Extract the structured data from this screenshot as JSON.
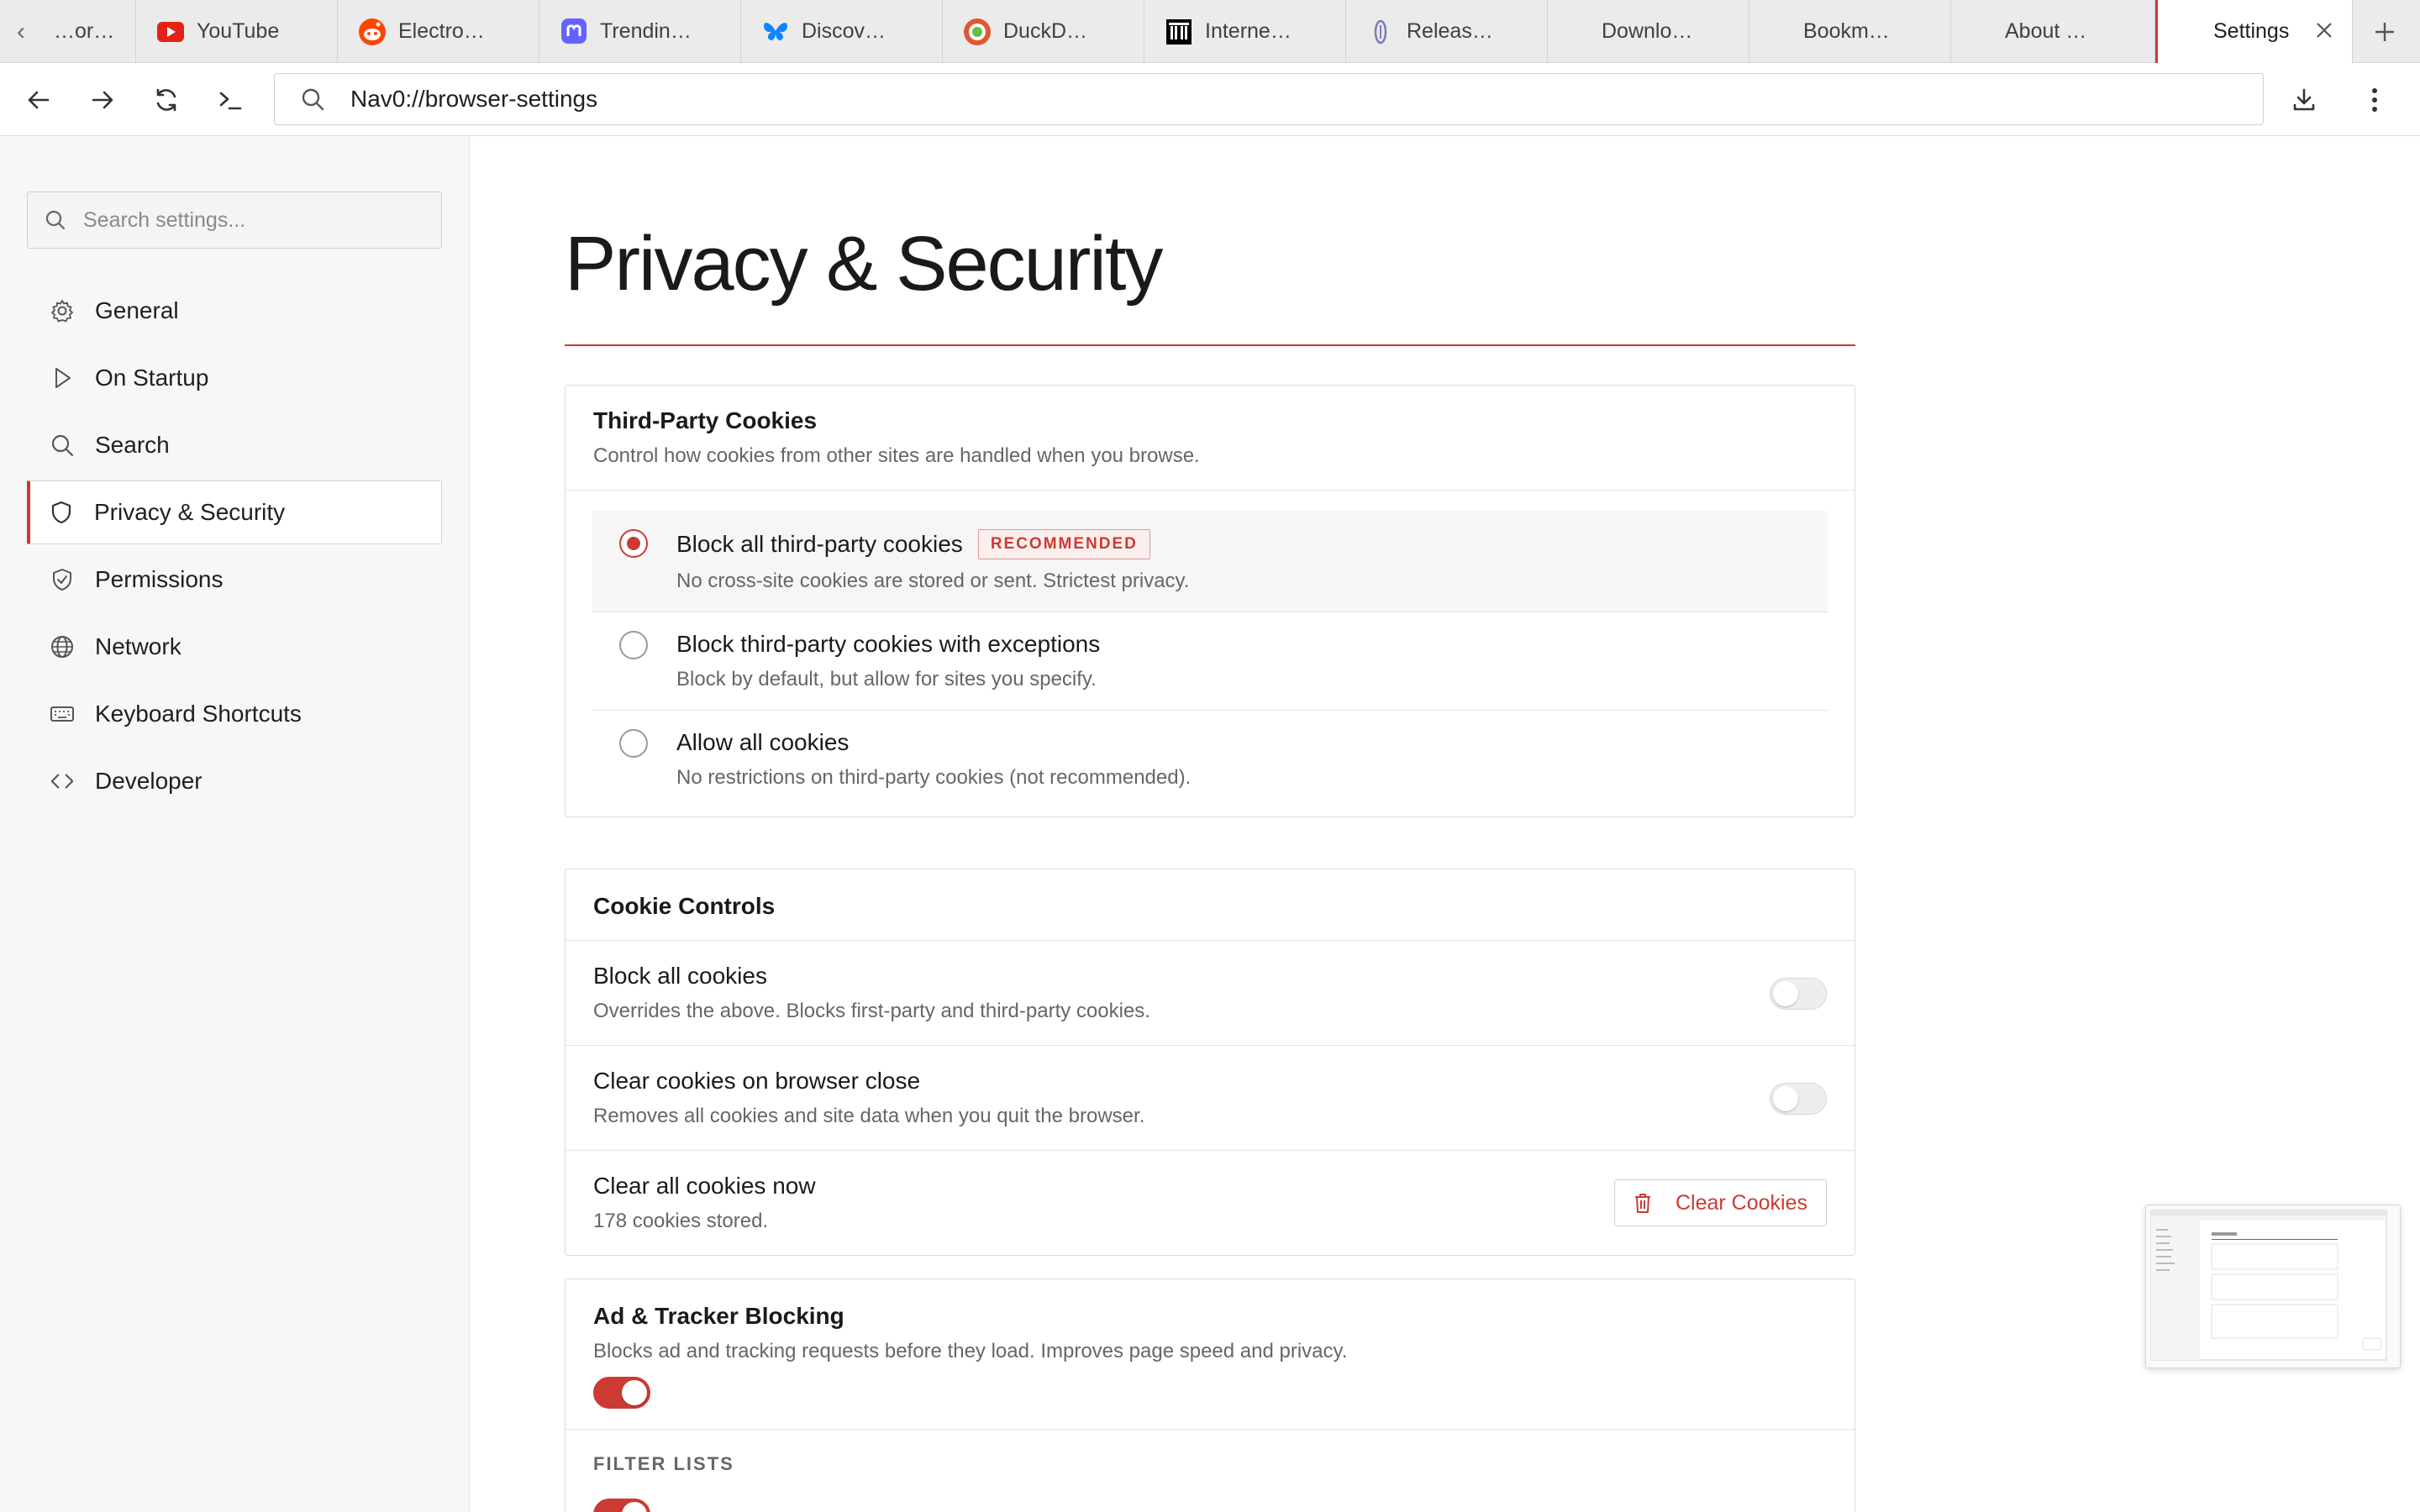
{
  "tabs": [
    {
      "label": "…or…",
      "icon": "page-icon",
      "color": "#888888"
    },
    {
      "label": "YouTube",
      "icon": "youtube-icon",
      "color": "#e62117"
    },
    {
      "label": "Electro…",
      "icon": "reddit-icon",
      "color": "#ff4500"
    },
    {
      "label": "Trendin…",
      "icon": "mastodon-icon",
      "color": "#6364ff"
    },
    {
      "label": "Discov…",
      "icon": "bluesky-icon",
      "color": "#1185fe"
    },
    {
      "label": "DuckD…",
      "icon": "duckduckgo-icon",
      "color": "#de5833"
    },
    {
      "label": "Interne…",
      "icon": "internet-archive-icon",
      "color": "#000000"
    },
    {
      "label": "Releas…",
      "icon": "release-icon",
      "color": "#7b7bbb"
    },
    {
      "label": "Downlo…",
      "icon": "",
      "color": ""
    },
    {
      "label": "Bookm…",
      "icon": "",
      "color": ""
    },
    {
      "label": "About …",
      "icon": "",
      "color": ""
    }
  ],
  "active_tab": {
    "label": "Settings"
  },
  "toolbar": {
    "url": "Nav0://browser-settings"
  },
  "sidebar": {
    "search_placeholder": "Search settings...",
    "items": [
      {
        "label": "General",
        "icon": "gear-icon"
      },
      {
        "label": "On Startup",
        "icon": "play-icon"
      },
      {
        "label": "Search",
        "icon": "search-icon"
      },
      {
        "label": "Privacy & Security",
        "icon": "shield-icon",
        "active": true
      },
      {
        "label": "Permissions",
        "icon": "shield-check-icon"
      },
      {
        "label": "Network",
        "icon": "globe-icon"
      },
      {
        "label": "Keyboard Shortcuts",
        "icon": "keyboard-icon"
      },
      {
        "label": "Developer",
        "icon": "code-icon"
      }
    ]
  },
  "main": {
    "title": "Privacy & Security",
    "third_party": {
      "title": "Third-Party Cookies",
      "desc": "Control how cookies from other sites are handled when you browse.",
      "options": [
        {
          "label": "Block all third-party cookies",
          "badge": "RECOMMENDED",
          "desc": "No cross-site cookies are stored or sent. Strictest privacy.",
          "selected": true
        },
        {
          "label": "Block third-party cookies with exceptions",
          "desc": "Block by default, but allow for sites you specify.",
          "selected": false
        },
        {
          "label": "Allow all cookies",
          "desc": "No restrictions on third-party cookies (not recommended).",
          "selected": false
        }
      ]
    },
    "cookie_controls": {
      "title": "Cookie Controls",
      "block_all": {
        "label": "Block all cookies",
        "desc": "Overrides the above. Blocks first-party and third-party cookies.",
        "on": false
      },
      "clear_on_close": {
        "label": "Clear cookies on browser close",
        "desc": "Removes all cookies and site data when you quit the browser.",
        "on": false
      },
      "clear_now": {
        "label": "Clear all cookies now",
        "desc": "178 cookies stored.",
        "button": "Clear Cookies"
      }
    },
    "ad_blocking": {
      "title": "Ad & Tracker Blocking",
      "desc": "Blocks ad and tracking requests before they load. Improves page speed and privacy.",
      "on": true,
      "filter_lists_label": "FILTER LISTS"
    }
  },
  "colors": {
    "accent": "#cc3a33",
    "sidebar_bg": "#f7f7f7",
    "tabstrip_bg": "#ebebeb"
  }
}
